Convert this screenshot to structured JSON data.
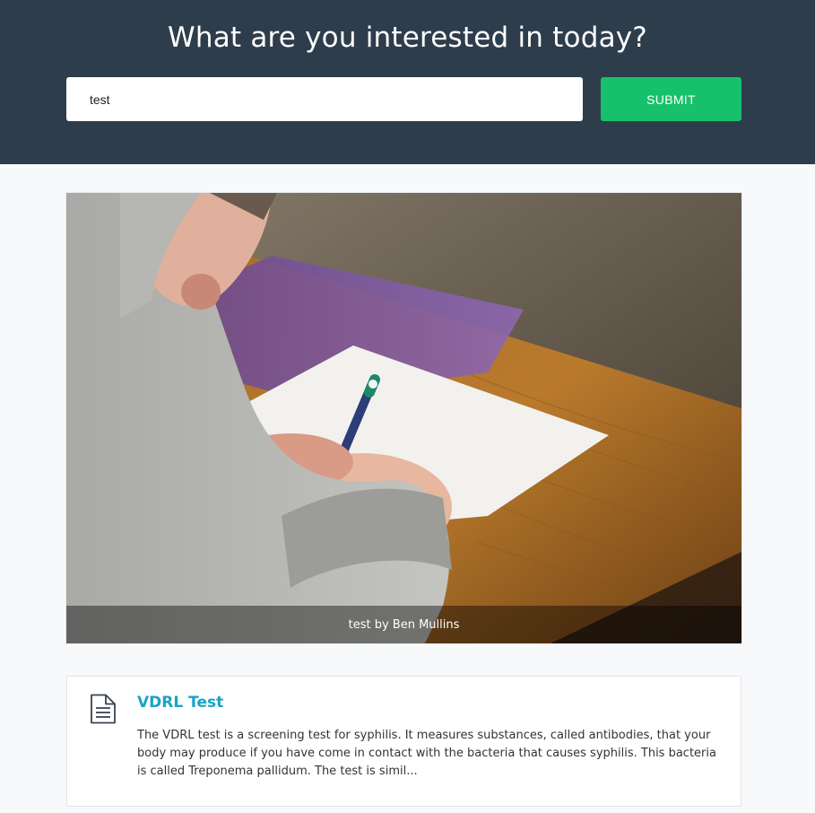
{
  "header": {
    "title": "What are you interested in today?",
    "search_value": "test",
    "submit_label": "SUBMIT",
    "accent_color": "#17c16b",
    "background_color": "#2e3d4c"
  },
  "feature": {
    "caption": "test by Ben Mullins"
  },
  "results": [
    {
      "icon": "document-icon",
      "title": "VDRL Test",
      "excerpt": "The VDRL test is a screening test for syphilis. It measures substances, called antibodies, that your body may produce if you have come in contact with the bacteria that causes syphilis. This bacteria is called Treponema pallidum. The test is simil...",
      "title_color": "#19a3c9"
    }
  ]
}
